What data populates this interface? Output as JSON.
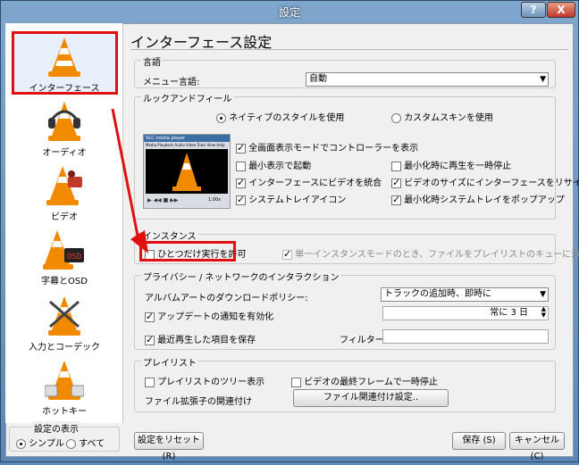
{
  "window": {
    "title": "設定",
    "help_label": "?",
    "close_label": "X"
  },
  "sidebar": {
    "items": [
      {
        "label": "インターフェース",
        "selected": true
      },
      {
        "label": "オーディオ"
      },
      {
        "label": "ビデオ"
      },
      {
        "label": "字幕とOSD"
      },
      {
        "label": "入力とコーデック"
      },
      {
        "label": "ホットキー"
      }
    ],
    "show_settings": {
      "title": "設定の表示",
      "options": [
        {
          "label": "シンプル",
          "selected": true
        },
        {
          "label": "すべて",
          "selected": false
        }
      ]
    }
  },
  "page_title": "インターフェース設定",
  "language": {
    "title": "言語",
    "menu_label": "メニュー言語:",
    "menu_value": "自動"
  },
  "look": {
    "title": "ルックアンドフィール",
    "native_label": "ネイティブのスタイルを使用",
    "native_selected": true,
    "skin_label": "カスタムスキンを使用",
    "skin_selected": false,
    "options": [
      {
        "label": "全画面表示モードでコントローラーを表示",
        "checked": true
      },
      {
        "label": "最小表示で起動",
        "checked": false
      },
      {
        "label": "最小化時に再生を一時停止",
        "checked": false
      },
      {
        "label": "インターフェースにビデオを統合",
        "checked": true
      },
      {
        "label": "ビデオのサイズにインターフェースをリサイズ",
        "checked": true
      },
      {
        "label": "システムトレイアイコン",
        "checked": true
      },
      {
        "label": "最小化時システムトレイをポップアップ",
        "checked": true
      }
    ],
    "preview_title": "VLC media player",
    "preview_menu": "Media Playback Audio Video Tools View Help",
    "preview_time": "1.00x"
  },
  "instance": {
    "title": "インスタンス",
    "single_label": "ひとつだけ実行を許可",
    "single_checked": false,
    "enqueue_label": "単一インスタンスモードのとき、ファイルをプレイリストのキューに追加",
    "enqueue_checked": false
  },
  "privacy": {
    "title": "プライバシー / ネットワークのインタラクション",
    "art_label": "アルバムアートのダウンロードポリシー:",
    "art_value": "トラックの追加時、即時に",
    "update_label": "アップデートの通知を有効化",
    "update_checked": true,
    "update_value": "常に 3 日",
    "recent_label": "最近再生した項目を保存",
    "recent_checked": true,
    "filter_label": "フィルター:",
    "filter_value": ""
  },
  "playlist": {
    "title": "プレイリスト",
    "tree_label": "プレイリストのツリー表示",
    "tree_checked": false,
    "pause_label": "ビデオの最終フレームで一時停止",
    "pause_checked": false,
    "assoc_label": "ファイル拡張子の関連付け",
    "assoc_button": "ファイル関連付け設定.."
  },
  "footer": {
    "reset_button": "設定をリセット (R)",
    "save_button": "保存 (S)",
    "cancel_button": "キャンセル (C)"
  },
  "colors": {
    "annotation_red": "#e01010",
    "cone_orange": "#f28a00"
  }
}
